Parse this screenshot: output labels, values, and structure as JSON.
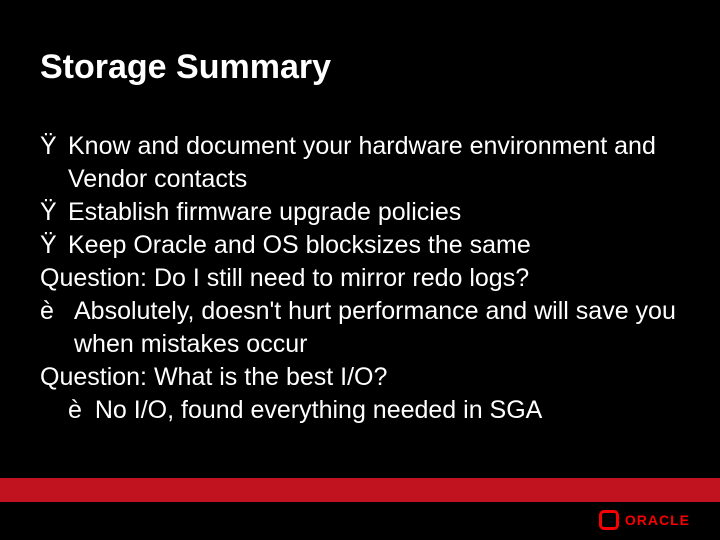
{
  "title": "Storage Summary",
  "bullets": {
    "b1": "Know and document your hardware environment and Vendor contacts",
    "b2": "Establish firmware upgrade policies",
    "b3": "Keep Oracle and OS blocksizes the same"
  },
  "q1": "Question: Do I still need to mirror redo logs?",
  "a1": "Absolutely, doesn't hurt performance and will save you when mistakes occur",
  "q2": "Question: What is the best I/O?",
  "a2_arrow": "è",
  "a2": "No I/O,  found everything needed in SGA",
  "bullet_char": "Ÿ",
  "arrow_char": "è",
  "logo_text": "ORACLE"
}
